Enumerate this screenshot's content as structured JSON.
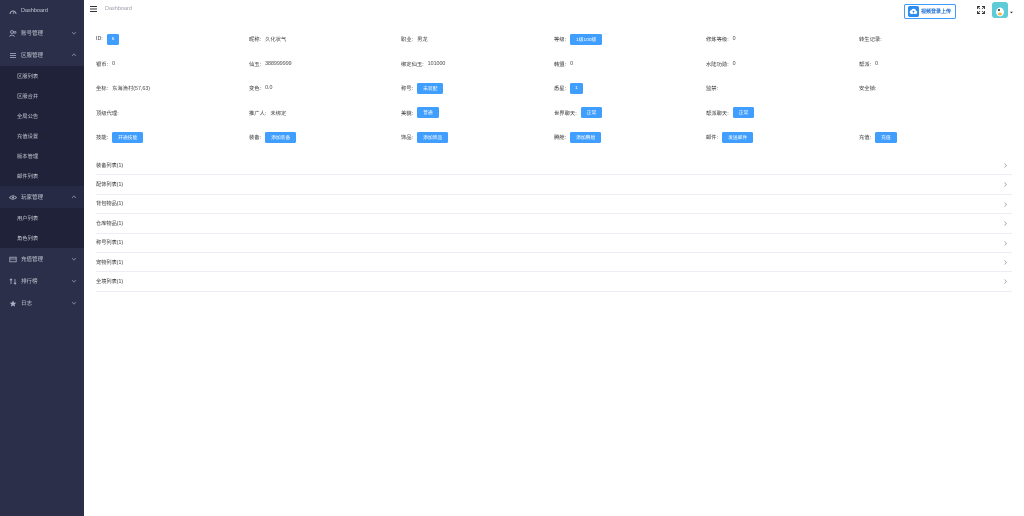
{
  "sidebar": {
    "items": [
      {
        "label": "Dashboard",
        "icon": "dashboard-icon"
      },
      {
        "label": "账号管理",
        "icon": "user-group-icon"
      },
      {
        "label": "区服管理",
        "icon": "list-icon"
      },
      {
        "label": "玩家管理",
        "icon": "eye-icon"
      },
      {
        "label": "充值管理",
        "icon": "card-icon"
      },
      {
        "label": "排行榜",
        "icon": "sort-icon"
      },
      {
        "label": "日志",
        "icon": "star-icon"
      }
    ],
    "server_children": [
      "区服列表",
      "区服合并",
      "全局公告",
      "充值设置",
      "版本管理",
      "邮件列表"
    ],
    "player_children": [
      "用户列表",
      "角色列表"
    ]
  },
  "header": {
    "breadcrumb": "Dashboard",
    "upload_label": "视频登录上传"
  },
  "info": {
    "id": {
      "label": "ID:",
      "value": "6"
    },
    "nickname": {
      "label": "昵称:",
      "value": "久化状气"
    },
    "job": {
      "label": "职业:",
      "value": "男龙"
    },
    "level": {
      "label": "等级:",
      "value": "1级100级"
    },
    "cultivation": {
      "label": "修炼等级:",
      "value": "0"
    },
    "rebirth": {
      "label": "转生记录:",
      "value": ""
    },
    "silver": {
      "label": "银币:",
      "value": "0"
    },
    "gold": {
      "label": "仙玉:",
      "value": "388999999"
    },
    "bound_gold": {
      "label": "绑定仙玉:",
      "value": "101000"
    },
    "hero": {
      "label": "韩盟:",
      "value": "0"
    },
    "water_land": {
      "label": "水陆功勋:",
      "value": "0"
    },
    "gang": {
      "label": "帮派:",
      "value": "0"
    },
    "coords": {
      "label": "坐标:",
      "value": "东海漁村(57,63)"
    },
    "color": {
      "label": "变色:",
      "value": "0.0"
    },
    "title": {
      "label": "称号:",
      "value": "未装配"
    },
    "stars": {
      "label": "悉星:",
      "value": "1"
    },
    "ban": {
      "label": "监禁:",
      "value": ""
    },
    "safe_lock": {
      "label": "安全锁:",
      "value": ""
    },
    "agent": {
      "label": "顶级代理:",
      "value": ""
    },
    "promoter": {
      "label": "推广人:",
      "value": "未绑定"
    },
    "beauty": {
      "label": "美貌:",
      "value": "普通"
    },
    "world_chat": {
      "label": "世界聊天:",
      "value": "正常"
    },
    "gang_chat": {
      "label": "帮派聊天:",
      "value": "正常"
    },
    "skill": {
      "label": "技能:",
      "value": "开通技能"
    },
    "equipment": {
      "label": "装备:",
      "value": "添加装备"
    },
    "items": {
      "label": "饰品:",
      "value": "添加饰品"
    },
    "mount": {
      "label": "腾舱:",
      "value": "添加腾舱"
    },
    "mail": {
      "label": "邮件:",
      "value": "发送邮件"
    },
    "recharge": {
      "label": "充值:",
      "value": "充值"
    }
  },
  "collapse_items": [
    "装备列表(1)",
    "配饰列表(1)",
    "背包物品(1)",
    "仓库物品(1)",
    "称号列表(1)",
    "宠物列表(1)",
    "全境列表(1)"
  ],
  "colors": {
    "sidebar_bg": "#2b2f4a",
    "sidebar_sub_bg": "#1f2238",
    "primary": "#409eff"
  }
}
